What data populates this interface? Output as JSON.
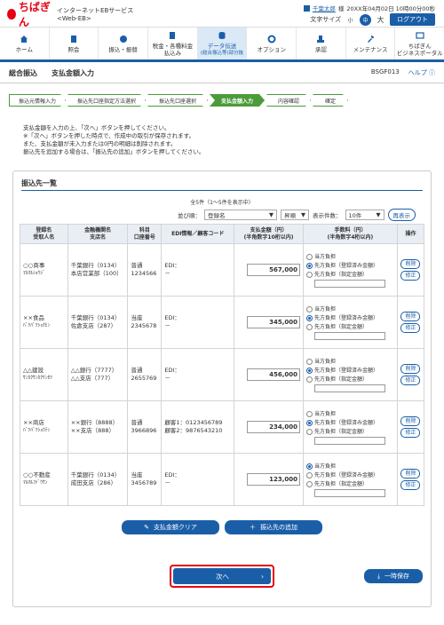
{
  "header": {
    "logo_text": "ちばぎん",
    "service_name": "インターネットEBサービス <Web-EB>",
    "user_name": "千葉太郎",
    "user_suffix": "様",
    "datetime": "20XX年04月02日 10時00分00秒",
    "text_size_label": "文字サイズ",
    "text_size_small": "小",
    "text_size_medium": "中",
    "text_size_large": "大",
    "logout_label": "ログアウト"
  },
  "nav": [
    {
      "label1": "ホーム",
      "label2": ""
    },
    {
      "label1": "照会",
      "label2": ""
    },
    {
      "label1": "振込・振替",
      "label2": ""
    },
    {
      "label1": "税金・各種料金",
      "label2": "払込み"
    },
    {
      "label1": "データ伝送",
      "label2": "(総合振込等)部分抜"
    },
    {
      "label1": "オプション",
      "label2": ""
    },
    {
      "label1": "承認",
      "label2": ""
    },
    {
      "label1": "メンテナンス",
      "label2": ""
    },
    {
      "label1": "ちばぎん",
      "label2": "ビジネスポータル"
    }
  ],
  "title": {
    "section": "総合振込",
    "page": "支払金額入力",
    "screen_id": "BSGF013",
    "help": "ヘルプ"
  },
  "steps": [
    "振込元情報入力",
    "振込先口座指定方法選択",
    "振込先口座選択",
    "支払金額入力",
    "内容確認",
    "確定"
  ],
  "instructions": [
    "支払金額を入力の上、「次へ」ボタンを押してください。",
    "※「次へ」ボタンを押した時点で、作成中の取引が保存されます。",
    "また、支払金額が未入力または0円の明細は削除されます。",
    "振込先を追加する場合は、「振込先の追加」ボタンを押してください。"
  ],
  "list": {
    "title": "振込先一覧",
    "count": "全5件（1～5件を表示中）",
    "sort_label": "並び順：",
    "sort_value": "登録名",
    "order_value": "昇順",
    "display_label": "表示件数：",
    "display_value": "10件",
    "redisplay": "再表示"
  },
  "table": {
    "headers": {
      "name": "登録名\n受取人名",
      "bank": "金融機関名\n支店名",
      "account": "科目\n口座番号",
      "edi": "EDI情報／顧客コード",
      "amount": "支払金額（円）\n(半角数字10桁以内)",
      "fee": "手数料（円）\n(半角数字4桁以内)",
      "op": "操作"
    },
    "rows": [
      {
        "name": "○○商事",
        "kana": "ﾏﾙﾏﾙｼｮｳｼﾞ",
        "bank": "千葉銀行（0134）",
        "branch": "本店営業部（100）",
        "type": "普通",
        "acct": "1234566",
        "edi1": "EDI：",
        "edi2": "－",
        "amount": "567,000",
        "fee_sel": 1
      },
      {
        "name": "××食品",
        "kana": "ﾊﾞﾂﾊﾞﾂｼｮｸﾋﾝ",
        "bank": "千葉銀行（0134）",
        "branch": "佐倉支店（287）",
        "type": "当座",
        "acct": "2345678",
        "edi1": "EDI：",
        "edi2": "－",
        "amount": "345,000",
        "fee_sel": 1
      },
      {
        "name": "△△建設",
        "kana": "ｻﾝｶｸｻﾝｶｸｹﾝｾﾂ",
        "bank": "△△銀行（7777）",
        "branch": "△△支店（777）",
        "type": "普通",
        "acct": "2655769",
        "edi1": "EDI：",
        "edi2": "－",
        "amount": "456,000",
        "fee_sel": 1
      },
      {
        "name": "××商店",
        "kana": "ﾊﾞﾂﾊﾞﾂｼｮｳﾃﾝ",
        "bank": "××銀行（8888）",
        "branch": "××支店（888）",
        "type": "普通",
        "acct": "3966896",
        "edi1": "顧客1：0123456789",
        "edi2": "顧客2：9876543210",
        "amount": "234,000",
        "fee_sel": 1
      },
      {
        "name": "○○不動産",
        "kana": "ﾏﾙﾏﾙﾌﾄﾞｳｻﾝ",
        "bank": "千葉銀行（0134）",
        "branch": "成田支店（286）",
        "type": "当座",
        "acct": "3456789",
        "edi1": "EDI：",
        "edi2": "－",
        "amount": "123,000",
        "fee_sel": 0
      }
    ],
    "fee_options": [
      "当方負担",
      "先方負担（登録済み金額）",
      "先方負担（指定金額）"
    ],
    "op_delete": "削除",
    "op_edit": "修正"
  },
  "buttons": {
    "clear": "支払金額クリア",
    "add": "振込先の追加",
    "next": "次へ",
    "save": "一時保存"
  }
}
